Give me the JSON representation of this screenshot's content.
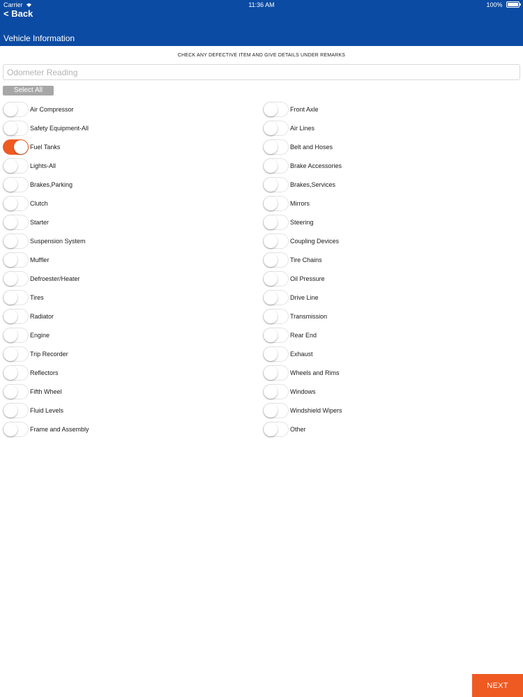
{
  "status_bar": {
    "carrier": "Carrier",
    "time": "11:36 AM",
    "battery": "100%"
  },
  "nav": {
    "back_label": "< Back",
    "title": "Vehicle Information"
  },
  "form": {
    "instruction": "CHECK ANY DEFECTIVE ITEM AND GIVE DETAILS UNDER REMARKS",
    "odometer_placeholder": "Odometer Reading",
    "odometer_value": "",
    "select_all_label": "Select All"
  },
  "toggle_on_color": "#ef5a22",
  "header_color": "#0b4ba3",
  "items_left": [
    {
      "label": "Air Compressor",
      "on": false
    },
    {
      "label": "Safety Equipment-All",
      "on": false
    },
    {
      "label": "Fuel Tanks",
      "on": true
    },
    {
      "label": "Lights-All",
      "on": false
    },
    {
      "label": "Brakes,Parking",
      "on": false
    },
    {
      "label": "Clutch",
      "on": false
    },
    {
      "label": "Starter",
      "on": false
    },
    {
      "label": "Suspension System",
      "on": false
    },
    {
      "label": "Muffler",
      "on": false
    },
    {
      "label": "Defroester/Heater",
      "on": false
    },
    {
      "label": "Tires",
      "on": false
    },
    {
      "label": "Radiator",
      "on": false
    },
    {
      "label": "Engine",
      "on": false
    },
    {
      "label": "Trip Recorder",
      "on": false
    },
    {
      "label": "Reflectors",
      "on": false
    },
    {
      "label": "Fifth Wheel",
      "on": false
    },
    {
      "label": "Fluid Levels",
      "on": false
    },
    {
      "label": "Frame and Assembly",
      "on": false
    }
  ],
  "items_right": [
    {
      "label": "Front Axle",
      "on": false
    },
    {
      "label": "Air Lines",
      "on": false
    },
    {
      "label": "Belt and Hoses",
      "on": false
    },
    {
      "label": "Brake Accessories",
      "on": false
    },
    {
      "label": "Brakes,Services",
      "on": false
    },
    {
      "label": "Mirrors",
      "on": false
    },
    {
      "label": "Steering",
      "on": false
    },
    {
      "label": "Coupling Devices",
      "on": false
    },
    {
      "label": "Tire Chains",
      "on": false
    },
    {
      "label": "Oil Pressure",
      "on": false
    },
    {
      "label": "Drive Line",
      "on": false
    },
    {
      "label": "Transmission",
      "on": false
    },
    {
      "label": "Rear End",
      "on": false
    },
    {
      "label": "Exhaust",
      "on": false
    },
    {
      "label": "Wheels and Rims",
      "on": false
    },
    {
      "label": "Windows",
      "on": false
    },
    {
      "label": "Windshield Wipers",
      "on": false
    },
    {
      "label": "Other",
      "on": false
    }
  ],
  "footer": {
    "next_label": "NEXT"
  }
}
